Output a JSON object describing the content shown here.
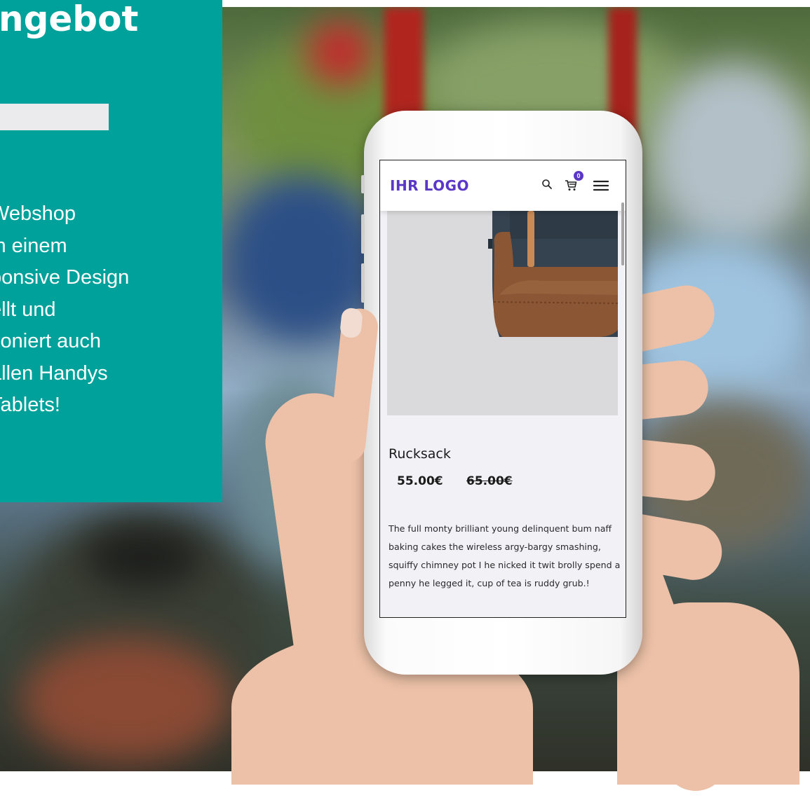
{
  "promo_panel": {
    "title": "ngebot",
    "lines": [
      "Webshop",
      "in einem",
      "ponsive Design",
      "ellt und",
      "tioniert auch",
      "allen Handys",
      "Tablets!"
    ],
    "background_color": "#00a19b"
  },
  "phone_screen": {
    "header": {
      "logo_text": "IHR LOGO",
      "logo_color": "#5b37c8",
      "icons": [
        "search-icon",
        "cart-icon",
        "menu-icon"
      ],
      "cart_count": "0"
    },
    "product": {
      "image": "backpack-photo",
      "title": "Rucksack",
      "price": "55.00€",
      "old_price": "65.00€",
      "description": "The full monty brilliant young delinquent bum naff baking cakes the wireless argy-bargy smashing, squiffy chimney pot I he nicked it twit brolly spend a penny he legged it, cup of tea is ruddy grub.!"
    }
  }
}
